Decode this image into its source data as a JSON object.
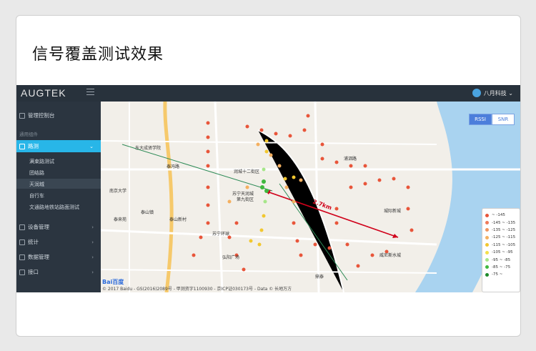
{
  "slide": {
    "title": "信号覆盖测试效果"
  },
  "topbar": {
    "logo": "AUGTEK",
    "user": "八月科技 ⌄"
  },
  "sidebar": {
    "items": [
      {
        "label": "管理控制台"
      },
      {
        "label": "路测"
      },
      {
        "label": "设备管理"
      },
      {
        "label": "统计"
      },
      {
        "label": "数据管理"
      },
      {
        "label": "接口"
      }
    ],
    "section": "通用组件",
    "subitems": [
      "满束路测试",
      "团结路",
      "天润城",
      "自行车",
      "文通路地铁站路面测试"
    ]
  },
  "map": {
    "tabs": [
      "RSSI",
      "SNR"
    ],
    "distance_label": "2.7km",
    "labels": {
      "a": "东大成贤学院",
      "b": "泰冯路",
      "c": "泰山新村",
      "d": "泰山镇",
      "e": "泰来苑",
      "f": "润城十二街区",
      "g": "苏宁天润城",
      "h": "第九街区",
      "i": "浦泗路",
      "j": "城际新城",
      "k": "苏宁环球",
      "l": "弘阳广场",
      "m": "南京大学",
      "n": "鼎泰",
      "o": "威尼斯水城"
    },
    "baidu": "Bai百度",
    "copyright": "© 2017 Baidu - GS(2016)2089号 - 甲测资字1100930 - 京ICP证030173号 - Data © 长地万方"
  },
  "legend": [
    {
      "label": "~ -145",
      "color": "#e8553a"
    },
    {
      "label": "-145 ~ -135",
      "color": "#ef7a5a"
    },
    {
      "label": "-135 ~ -125",
      "color": "#f0955f"
    },
    {
      "label": "-125 ~ -115",
      "color": "#f4b060"
    },
    {
      "label": "-115 ~ -105",
      "color": "#f2c72f"
    },
    {
      "label": "-105 ~ -95",
      "color": "#f4e04a"
    },
    {
      "label": "-95 ~ -85",
      "color": "#a7e68a"
    },
    {
      "label": "-85 ~ -75",
      "color": "#3fb83f"
    },
    {
      "label": "-75 ~",
      "color": "#1d8a2a"
    }
  ]
}
